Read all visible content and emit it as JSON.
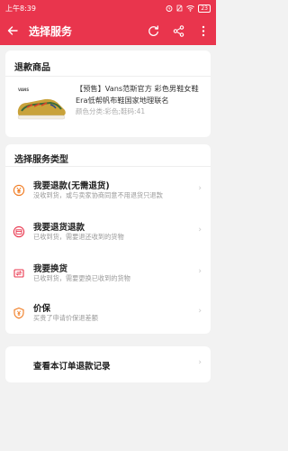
{
  "status_bar": {
    "time": "上午8:39",
    "battery": "23"
  },
  "header": {
    "title": "选择服务",
    "background_color": "#e9354d"
  },
  "goods_section": {
    "title": "退款商品",
    "product": {
      "name": "【预售】Vans范斯官方 彩色男鞋女鞋Era低帮帆布鞋国家地理联名",
      "sku": "颜色分类:彩色;鞋码:41"
    }
  },
  "service_section": {
    "title": "选择服务类型",
    "items": [
      {
        "icon": "yen-icon",
        "name": "我要退款(无需退货)",
        "desc": "没收到货，或与卖家协商同意不用退货只退款"
      },
      {
        "icon": "return-box-icon",
        "name": "我要退货退款",
        "desc": "已收到货，需要退还收到的货物"
      },
      {
        "icon": "exchange-icon",
        "name": "我要换货",
        "desc": "已收到货，需要更换已收到的货物"
      },
      {
        "icon": "price-protect-icon",
        "name": "价保",
        "desc": "买贵了申请价保退差额"
      }
    ]
  },
  "records": {
    "label": "查看本订单退款记录"
  },
  "accent_color": "#f07a1f"
}
